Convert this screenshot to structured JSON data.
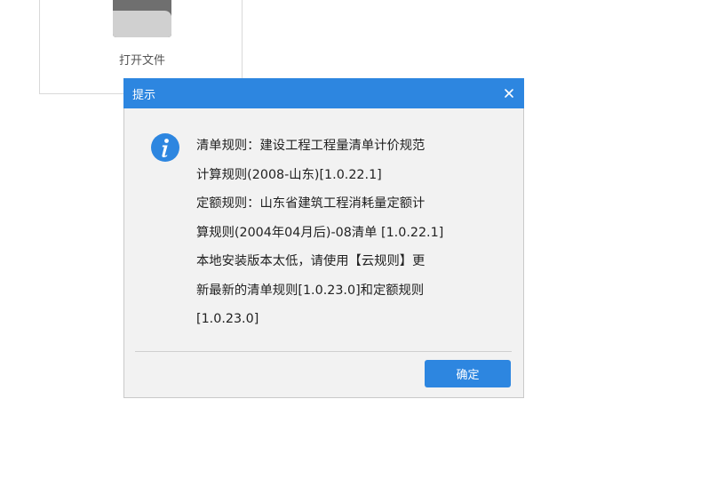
{
  "background": {
    "open_file_label": "打开文件"
  },
  "dialog": {
    "title": "提示",
    "close_glyph": "×",
    "icon": "info-icon",
    "message_lines": [
      "清单规则：建设工程工程量清单计价规范",
      "计算规则(2008-山东)[1.0.22.1]",
      "定额规则：山东省建筑工程消耗量定额计",
      "算规则(2004年04月后)-08清单 [1.0.22.1]",
      "本地安装版本太低，请使用【云规则】更",
      "新最新的清单规则[1.0.23.0]和定额规则",
      "[1.0.23.0]"
    ],
    "ok_label": "确定"
  },
  "colors": {
    "accent": "#2d86e0",
    "dialog_bg": "#f2f2f2",
    "text": "#222222"
  }
}
